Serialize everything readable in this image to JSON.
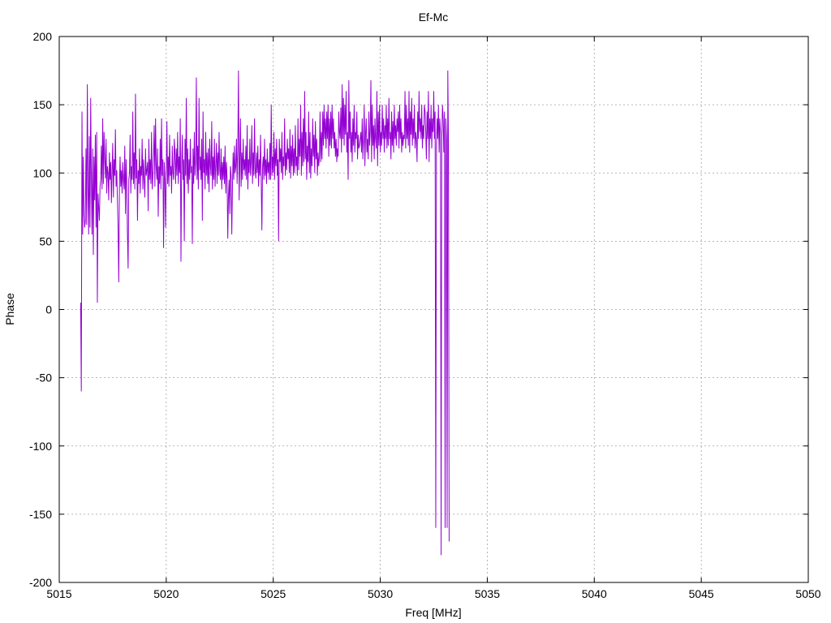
{
  "chart_data": {
    "type": "line",
    "title": "Ef-Mc",
    "xlabel": "Freq [MHz]",
    "ylabel": "Phase",
    "xlim": [
      5015,
      5050
    ],
    "ylim": [
      -200,
      200
    ],
    "x_ticks": [
      5015,
      5020,
      5025,
      5030,
      5035,
      5040,
      5045,
      5050
    ],
    "y_ticks": [
      -200,
      -150,
      -100,
      -50,
      0,
      50,
      100,
      150,
      200
    ],
    "grid": true,
    "line_color": "#9400d3",
    "series": [
      {
        "x_start": 5016.0,
        "x_step": 0.03125,
        "values": [
          5,
          -60,
          145,
          55,
          112,
          70,
          60,
          65,
          118,
          62,
          165,
          90,
          55,
          127,
          60,
          155,
          95,
          55,
          118,
          40,
          112,
          80,
          128,
          60,
          130,
          5,
          85,
          75,
          65,
          90,
          95,
          120,
          88,
          140,
          92,
          130,
          110,
          96,
          125,
          85,
          105,
          100,
          80,
          115,
          95,
          108,
          78,
          100,
          122,
          82,
          110,
          98,
          132,
          90,
          102,
          80,
          60,
          20,
          90,
          112,
          90,
          102,
          85,
          108,
          95,
          88,
          120,
          70,
          110,
          92,
          55,
          30,
          95,
          100,
          128,
          85,
          105,
          95,
          145,
          92,
          115,
          88,
          158,
          96,
          110,
          65,
          102,
          92,
          118,
          85,
          105,
          98,
          125,
          88,
          110,
          95,
          82,
          118,
          98,
          102,
          108,
          72,
          125,
          95,
          110,
          92,
          130,
          88,
          98,
          112,
          135,
          90,
          140,
          105,
          95,
          118,
          68,
          105,
          92,
          125,
          88,
          140,
          98,
          110,
          45,
          108,
          95,
          60,
          102,
          138,
          92,
          112,
          90,
          128,
          98,
          105,
          85,
          120,
          100,
          95,
          125,
          115,
          92,
          118,
          98,
          130,
          92,
          112,
          100,
          140,
          35,
          105,
          128,
          95,
          110,
          50,
          125,
          98,
          155,
          92,
          118,
          85,
          110,
          95,
          125,
          100,
          105,
          48,
          118,
          92,
          130,
          98,
          108,
          170,
          95,
          120,
          88,
          155,
          102,
          112,
          95,
          125,
          65,
          145,
          100,
          110,
          88,
          130,
          98,
          115,
          92,
          118,
          86,
          125,
          105,
          98,
          138,
          88,
          112,
          95,
          125,
          90,
          105,
          122,
          92,
          115,
          98,
          130,
          102,
          95,
          118,
          88,
          108,
          95,
          112,
          92,
          120,
          85,
          108,
          95,
          52,
          82,
          95,
          70,
          105,
          98,
          55,
          90,
          115,
          95,
          120,
          100,
          105,
          125,
          92,
          118,
          175,
          80,
          108,
          140,
          90,
          115,
          95,
          125,
          102,
          110,
          98,
          120,
          95,
          135,
          88,
          110,
          100,
          125,
          98,
          108,
          135,
          92,
          115,
          98,
          140,
          102,
          96,
          115,
          100,
          120,
          90,
          110,
          98,
          128,
          95,
          58,
          105,
          112,
          95,
          125,
          98,
          110,
          92,
          118,
          100,
          108,
          95,
          122,
          95,
          150,
          98,
          112,
          100,
          130,
          95,
          118,
          105,
          125,
          98,
          110,
          50,
          125,
          108,
          118,
          100,
          130,
          95,
          112,
          105,
          140,
          98,
          115,
          102,
          125,
          110,
          118,
          100,
          132,
          96,
          120,
          105,
          128,
          98,
          118,
          100,
          135,
          105,
          112,
          98,
          140,
          102,
          125,
          112,
          150,
          98,
          130,
          105,
          140,
          108,
          160,
          110,
          130,
          95,
          120,
          108,
          145,
          100,
          130,
          96,
          118,
          105,
          140,
          112,
          128,
          100,
          138,
          110,
          125,
          98,
          115,
          105,
          112,
          145,
          108,
          130,
          110,
          145,
          120,
          150,
          125,
          140,
          118,
          145,
          125,
          150,
          112,
          140,
          120,
          145,
          118,
          150,
          125,
          140,
          118,
          130,
          112,
          125,
          108,
          118,
          112,
          145,
          130,
          125,
          148,
          115,
          165,
          125,
          155,
          120,
          150,
          128,
          160,
          115,
          130,
          95,
          168,
          125,
          145,
          115,
          130,
          108,
          140,
          120,
          150,
          115,
          130,
          125,
          145,
          110,
          128,
          118,
          120,
          125,
          130,
          115,
          140,
          110,
          125,
          150,
          105,
          128,
          140,
          115,
          125,
          110,
          145,
          120,
          130,
          168,
          108,
          150,
          120,
          135,
          110,
          140,
          125,
          118,
          160,
          105,
          145,
          120,
          150,
          115,
          130,
          120,
          150,
          125,
          140,
          115,
          135,
          125,
          150,
          118,
          140,
          120,
          155,
          125,
          130,
          110,
          145,
          120,
          138,
          115,
          150,
          125,
          135,
          120,
          140,
          130,
          145,
          118,
          150,
          125,
          140,
          115,
          130,
          120,
          128,
          125,
          160,
          118,
          150,
          125,
          140,
          120,
          160,
          115,
          145,
          128,
          155,
          120,
          140,
          125,
          150,
          118,
          130,
          125,
          108,
          145,
          125,
          160,
          130,
          140,
          125,
          150,
          118,
          135,
          125,
          150,
          145,
          130,
          110,
          145,
          125,
          160,
          108,
          140,
          125,
          150,
          118,
          140,
          130,
          160,
          125,
          145,
          -160,
          120,
          140,
          125,
          150,
          115,
          140,
          130,
          -180,
          125,
          150,
          140,
          115,
          145,
          -160,
          140,
          125,
          -160,
          175,
          120,
          -170
        ]
      }
    ]
  }
}
